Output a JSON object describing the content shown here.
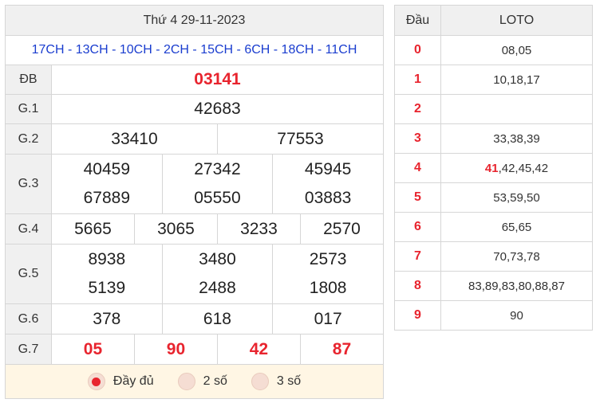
{
  "header": {
    "date": "Thứ 4 29-11-2023",
    "codes": "17CH - 13CH - 10CH - 2CH - 15CH - 6CH - 18CH - 11CH"
  },
  "prizes": {
    "db": {
      "label": "ĐB",
      "values": [
        "03141"
      ]
    },
    "g1": {
      "label": "G.1",
      "values": [
        "42683"
      ]
    },
    "g2": {
      "label": "G.2",
      "values": [
        "33410",
        "77553"
      ]
    },
    "g3": {
      "label": "G.3",
      "values": [
        "40459",
        "27342",
        "45945",
        "67889",
        "05550",
        "03883"
      ]
    },
    "g4": {
      "label": "G.4",
      "values": [
        "5665",
        "3065",
        "3233",
        "2570"
      ]
    },
    "g5": {
      "label": "G.5",
      "values": [
        "8938",
        "3480",
        "2573",
        "5139",
        "2488",
        "1808"
      ]
    },
    "g6": {
      "label": "G.6",
      "values": [
        "378",
        "618",
        "017"
      ]
    },
    "g7": {
      "label": "G.7",
      "values": [
        "05",
        "90",
        "42",
        "87"
      ]
    }
  },
  "modes": {
    "selected": "full",
    "options": [
      {
        "id": "full",
        "label": "Đầy đủ"
      },
      {
        "id": "two",
        "label": "2 số"
      },
      {
        "id": "three",
        "label": "3 số"
      }
    ]
  },
  "loto": {
    "head_col": "Đầu",
    "loto_col": "LOTO",
    "rows": [
      {
        "head": "0",
        "values": "08,05"
      },
      {
        "head": "1",
        "values": "10,18,17"
      },
      {
        "head": "2",
        "values": ""
      },
      {
        "head": "3",
        "values": "33,38,39"
      },
      {
        "head": "4",
        "highlight": "41",
        "values": ",42,45,42"
      },
      {
        "head": "5",
        "values": "53,59,50"
      },
      {
        "head": "6",
        "values": "65,65"
      },
      {
        "head": "7",
        "values": "70,73,78"
      },
      {
        "head": "8",
        "values": "83,89,83,80,88,87"
      },
      {
        "head": "9",
        "values": "90"
      }
    ]
  },
  "colors": {
    "accent_red": "#e8242e",
    "code_blue": "#1a3dcf",
    "header_bg": "#f0f0f0",
    "mode_bg": "#fff6e4"
  }
}
